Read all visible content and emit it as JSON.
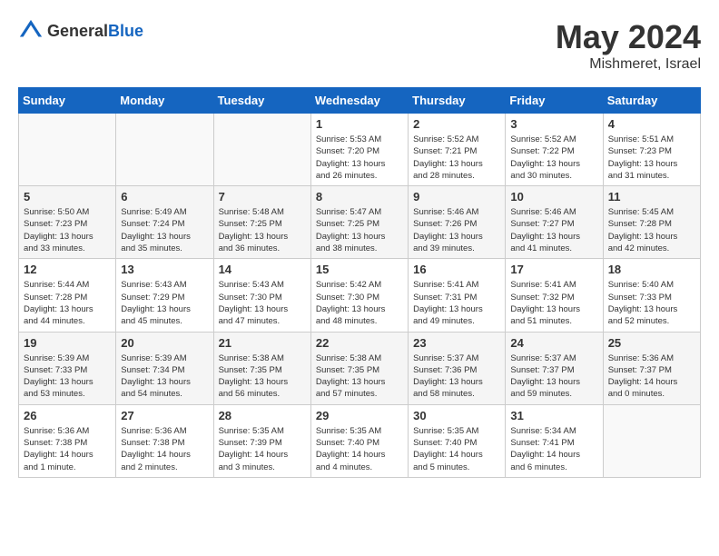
{
  "header": {
    "logo_general": "General",
    "logo_blue": "Blue",
    "title": "May 2024",
    "subtitle": "Mishmeret, Israel"
  },
  "days_of_week": [
    "Sunday",
    "Monday",
    "Tuesday",
    "Wednesday",
    "Thursday",
    "Friday",
    "Saturday"
  ],
  "weeks": [
    {
      "days": [
        {
          "num": "",
          "info": ""
        },
        {
          "num": "",
          "info": ""
        },
        {
          "num": "",
          "info": ""
        },
        {
          "num": "1",
          "info": "Sunrise: 5:53 AM\nSunset: 7:20 PM\nDaylight: 13 hours\nand 26 minutes."
        },
        {
          "num": "2",
          "info": "Sunrise: 5:52 AM\nSunset: 7:21 PM\nDaylight: 13 hours\nand 28 minutes."
        },
        {
          "num": "3",
          "info": "Sunrise: 5:52 AM\nSunset: 7:22 PM\nDaylight: 13 hours\nand 30 minutes."
        },
        {
          "num": "4",
          "info": "Sunrise: 5:51 AM\nSunset: 7:23 PM\nDaylight: 13 hours\nand 31 minutes."
        }
      ]
    },
    {
      "days": [
        {
          "num": "5",
          "info": "Sunrise: 5:50 AM\nSunset: 7:23 PM\nDaylight: 13 hours\nand 33 minutes."
        },
        {
          "num": "6",
          "info": "Sunrise: 5:49 AM\nSunset: 7:24 PM\nDaylight: 13 hours\nand 35 minutes."
        },
        {
          "num": "7",
          "info": "Sunrise: 5:48 AM\nSunset: 7:25 PM\nDaylight: 13 hours\nand 36 minutes."
        },
        {
          "num": "8",
          "info": "Sunrise: 5:47 AM\nSunset: 7:25 PM\nDaylight: 13 hours\nand 38 minutes."
        },
        {
          "num": "9",
          "info": "Sunrise: 5:46 AM\nSunset: 7:26 PM\nDaylight: 13 hours\nand 39 minutes."
        },
        {
          "num": "10",
          "info": "Sunrise: 5:46 AM\nSunset: 7:27 PM\nDaylight: 13 hours\nand 41 minutes."
        },
        {
          "num": "11",
          "info": "Sunrise: 5:45 AM\nSunset: 7:28 PM\nDaylight: 13 hours\nand 42 minutes."
        }
      ]
    },
    {
      "days": [
        {
          "num": "12",
          "info": "Sunrise: 5:44 AM\nSunset: 7:28 PM\nDaylight: 13 hours\nand 44 minutes."
        },
        {
          "num": "13",
          "info": "Sunrise: 5:43 AM\nSunset: 7:29 PM\nDaylight: 13 hours\nand 45 minutes."
        },
        {
          "num": "14",
          "info": "Sunrise: 5:43 AM\nSunset: 7:30 PM\nDaylight: 13 hours\nand 47 minutes."
        },
        {
          "num": "15",
          "info": "Sunrise: 5:42 AM\nSunset: 7:30 PM\nDaylight: 13 hours\nand 48 minutes."
        },
        {
          "num": "16",
          "info": "Sunrise: 5:41 AM\nSunset: 7:31 PM\nDaylight: 13 hours\nand 49 minutes."
        },
        {
          "num": "17",
          "info": "Sunrise: 5:41 AM\nSunset: 7:32 PM\nDaylight: 13 hours\nand 51 minutes."
        },
        {
          "num": "18",
          "info": "Sunrise: 5:40 AM\nSunset: 7:33 PM\nDaylight: 13 hours\nand 52 minutes."
        }
      ]
    },
    {
      "days": [
        {
          "num": "19",
          "info": "Sunrise: 5:39 AM\nSunset: 7:33 PM\nDaylight: 13 hours\nand 53 minutes."
        },
        {
          "num": "20",
          "info": "Sunrise: 5:39 AM\nSunset: 7:34 PM\nDaylight: 13 hours\nand 54 minutes."
        },
        {
          "num": "21",
          "info": "Sunrise: 5:38 AM\nSunset: 7:35 PM\nDaylight: 13 hours\nand 56 minutes."
        },
        {
          "num": "22",
          "info": "Sunrise: 5:38 AM\nSunset: 7:35 PM\nDaylight: 13 hours\nand 57 minutes."
        },
        {
          "num": "23",
          "info": "Sunrise: 5:37 AM\nSunset: 7:36 PM\nDaylight: 13 hours\nand 58 minutes."
        },
        {
          "num": "24",
          "info": "Sunrise: 5:37 AM\nSunset: 7:37 PM\nDaylight: 13 hours\nand 59 minutes."
        },
        {
          "num": "25",
          "info": "Sunrise: 5:36 AM\nSunset: 7:37 PM\nDaylight: 14 hours\nand 0 minutes."
        }
      ]
    },
    {
      "days": [
        {
          "num": "26",
          "info": "Sunrise: 5:36 AM\nSunset: 7:38 PM\nDaylight: 14 hours\nand 1 minute."
        },
        {
          "num": "27",
          "info": "Sunrise: 5:36 AM\nSunset: 7:38 PM\nDaylight: 14 hours\nand 2 minutes."
        },
        {
          "num": "28",
          "info": "Sunrise: 5:35 AM\nSunset: 7:39 PM\nDaylight: 14 hours\nand 3 minutes."
        },
        {
          "num": "29",
          "info": "Sunrise: 5:35 AM\nSunset: 7:40 PM\nDaylight: 14 hours\nand 4 minutes."
        },
        {
          "num": "30",
          "info": "Sunrise: 5:35 AM\nSunset: 7:40 PM\nDaylight: 14 hours\nand 5 minutes."
        },
        {
          "num": "31",
          "info": "Sunrise: 5:34 AM\nSunset: 7:41 PM\nDaylight: 14 hours\nand 6 minutes."
        },
        {
          "num": "",
          "info": ""
        }
      ]
    }
  ]
}
